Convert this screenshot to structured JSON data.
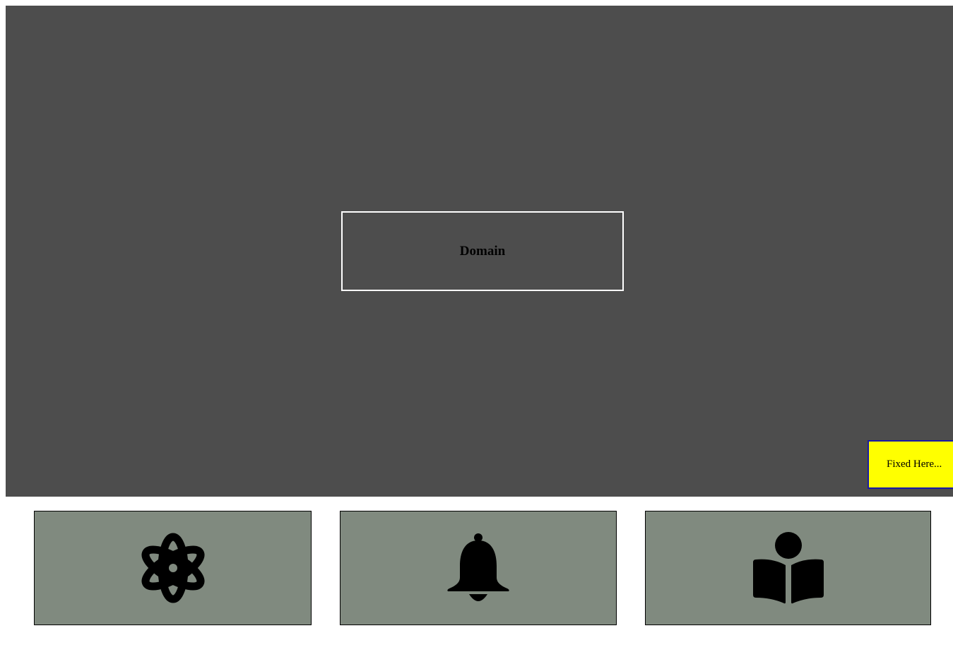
{
  "hero": {
    "domain_label": "Domain",
    "background": "#4d4d4d"
  },
  "fixed_badge": {
    "label": "Fixed Here...",
    "background": "#ffff00",
    "border_color": "#1a1aa6"
  },
  "cards": [
    {
      "icon": "atom-icon"
    },
    {
      "icon": "bell-icon"
    },
    {
      "icon": "book-reader-icon"
    }
  ],
  "card_color": "#808a7f"
}
